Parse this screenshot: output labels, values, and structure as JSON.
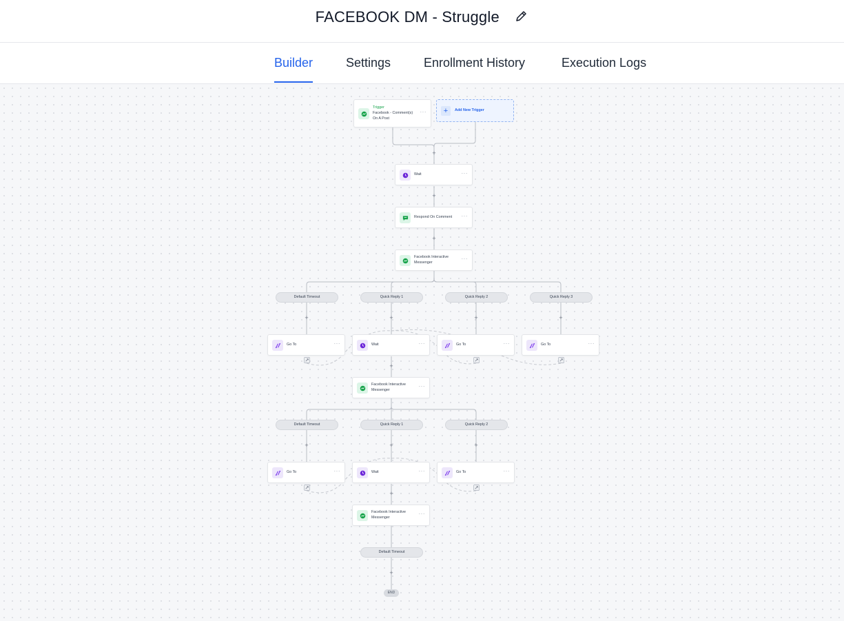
{
  "header": {
    "title": "FACEBOOK DM - Struggle"
  },
  "tabs": [
    "Builder",
    "Settings",
    "Enrollment History",
    "Execution Logs"
  ],
  "active_tab": "Builder",
  "colors": {
    "accent": "#2563eb",
    "messenger_green": "#16a34a",
    "goto_purple": "#7c3aed"
  },
  "workflow": {
    "trigger": {
      "kicker": "Trigger",
      "label": "Facebook - Comment(s) On A Post",
      "icon": "messenger-icon"
    },
    "add_trigger_label": "Add New Trigger",
    "step_wait": "Wait",
    "step_respond": "Respond On Comment",
    "step_fb_messenger": "Facebook Interactive Messenger",
    "step_goto": "Go To",
    "branch_default": "Default Timeout",
    "branch_qr1": "Quick Reply 1",
    "branch_qr2": "Quick Reply 2",
    "branch_qr3": "Quick Reply 3",
    "add_symbol": "+",
    "end_label": "END",
    "more_symbol": "···"
  }
}
